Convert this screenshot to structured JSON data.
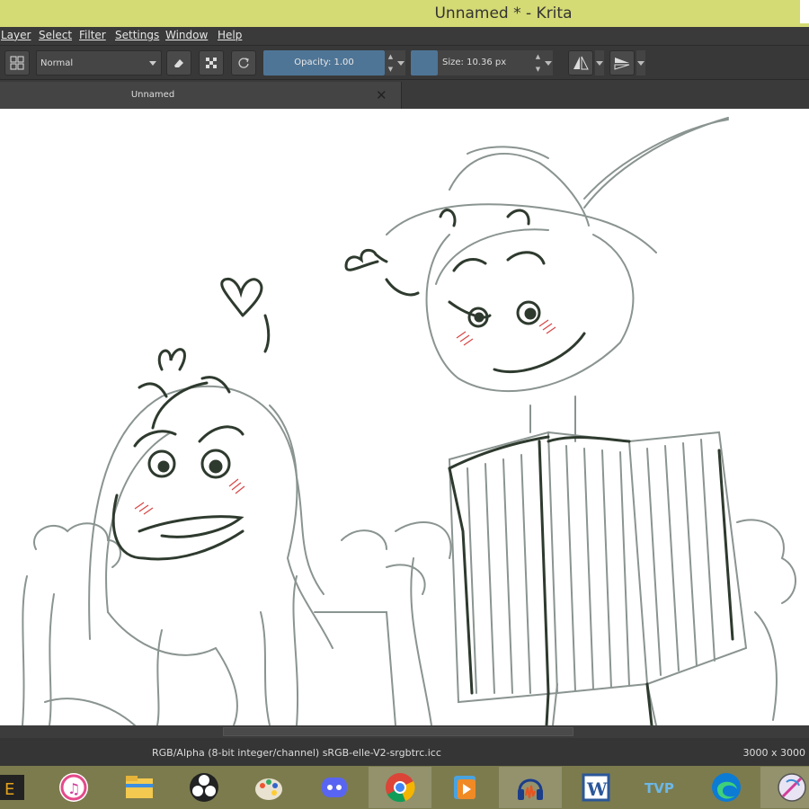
{
  "window": {
    "title": "Unnamed * - Krita"
  },
  "menu": [
    "Layer",
    "Select",
    "Filter",
    "Settings",
    "Window",
    "Help"
  ],
  "toolbar": {
    "blend_mode": "Normal",
    "opacity_label": "Opacity:  1.00",
    "size_label": "Size:  10.36 px"
  },
  "document_tab": {
    "label": "Unnamed"
  },
  "status": {
    "color_profile": "RGB/Alpha (8-bit integer/channel)  sRGB-elle-V2-srgbtrc.icc",
    "dimensions": "3000 x 3000"
  },
  "colors": {
    "titlebar": "#d4da74",
    "accent": "#4f7596",
    "taskbar": "#7c7b4e",
    "sketch_dark": "#2e3a2e",
    "sketch_light": "#8a9490",
    "blush": "#d94545"
  },
  "taskbar": [
    "game-app-icon",
    "itunes-icon",
    "file-explorer-icon",
    "obs-icon",
    "paint-palette-icon",
    "discord-icon",
    "chrome-icon",
    "video-player-icon",
    "audacity-icon",
    "word-icon",
    "tvp-icon",
    "edge-icon",
    "krita-icon"
  ]
}
